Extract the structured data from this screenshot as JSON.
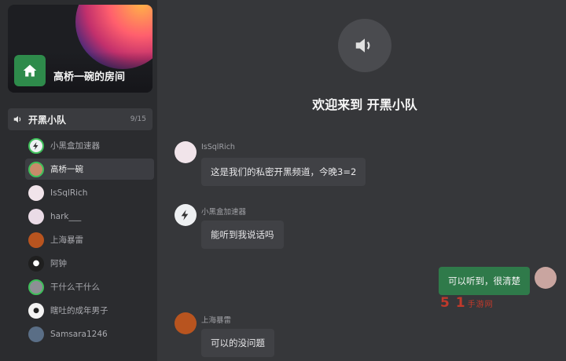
{
  "room": {
    "name": "高桥一碗的房间"
  },
  "channel": {
    "name": "开黑小队",
    "count": "9/15"
  },
  "members": [
    {
      "name": "小黑盒加速器",
      "icon": "lightning",
      "speaking": true,
      "active": false
    },
    {
      "name": "高桥一碗",
      "icon": "person",
      "speaking": true,
      "active": true
    },
    {
      "name": "IsSqlRich",
      "icon": "anime",
      "speaking": false,
      "active": false
    },
    {
      "name": "hark___",
      "icon": "anime",
      "speaking": false,
      "active": false
    },
    {
      "name": "上海暴雷",
      "icon": "person",
      "speaking": false,
      "active": false
    },
    {
      "name": "阿钟",
      "icon": "panda",
      "speaking": false,
      "active": false
    },
    {
      "name": "干什么干什么",
      "icon": "person",
      "speaking": true,
      "active": false
    },
    {
      "name": "瞎吐的成年男子",
      "icon": "egg",
      "speaking": false,
      "active": false
    },
    {
      "name": "Samsara1246",
      "icon": "person",
      "speaking": false,
      "active": false
    }
  ],
  "main": {
    "welcome": "欢迎来到 开黑小队"
  },
  "messages": [
    {
      "user": "IsSqlRich",
      "text": "这是我们的私密开黑频道，今晚3=2"
    },
    {
      "user": "小黑盒加速器",
      "text": "能听到我说话吗"
    },
    {
      "user": "",
      "text": "可以听到，很清楚"
    },
    {
      "user": "上海暴雷",
      "text": "可以的没问题"
    }
  ],
  "watermark": {
    "main": "5 1",
    "sub": "手游网"
  },
  "colors": {
    "accent_green": "#2e8b4b",
    "speaking_ring": "#3fbf5a",
    "my_bubble": "#2f7a4a"
  }
}
